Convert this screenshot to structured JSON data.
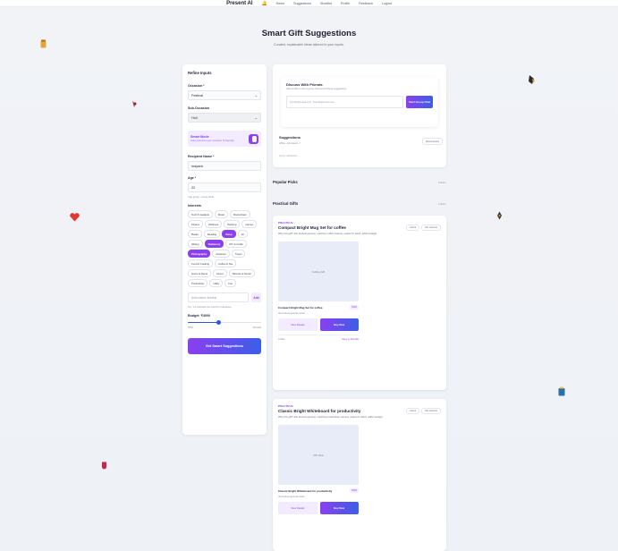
{
  "nav": {
    "brand": "Present AI",
    "links": [
      "Home",
      "Suggestions",
      "Shortlist",
      "Profile",
      "Feedback",
      "Logout"
    ]
  },
  "hero": {
    "title": "Smart Gift Suggestions",
    "subtitle": "Curated, explainable ideas tailored to your inputs."
  },
  "form": {
    "heading": "Refine Inputs",
    "occasion_label": "Occasion *",
    "occasion_value": "Festival",
    "sub_occasion_label": "Sub-Occasion",
    "sub_occasion_value": "Holi",
    "smart_mode_label": "Smart Mode",
    "smart_mode_desc": "Auto-optimizes per occasion & diversity",
    "recipient_label": "Recipient Name *",
    "recipient_value": "mayank",
    "age_label": "Age *",
    "age_value": "22",
    "age_hint": "Age group: young adult",
    "interests_label": "Interests",
    "interests": [
      {
        "label": "Tech & Gadgets",
        "on": false
      },
      {
        "label": "Music",
        "on": false
      },
      {
        "label": "Books/Gam",
        "on": false
      },
      {
        "label": "Fitness",
        "on": false
      },
      {
        "label": "Wellness",
        "on": false
      },
      {
        "label": "Painting",
        "on": false
      },
      {
        "label": "Games",
        "on": false
      },
      {
        "label": "Books",
        "on": false
      },
      {
        "label": "Reading",
        "on": false
      },
      {
        "label": "Sleep",
        "on": true
      },
      {
        "label": "Art",
        "on": false
      },
      {
        "label": "Writing",
        "on": false
      },
      {
        "label": "Stationery",
        "on": true
      },
      {
        "label": "DIY & Crafts",
        "on": false
      },
      {
        "label": "Photography",
        "on": true
      },
      {
        "label": "Outdoors",
        "on": false
      },
      {
        "label": "Travel",
        "on": false
      },
      {
        "label": "Food & Cooking",
        "on": false
      },
      {
        "label": "Coffee & Tea",
        "on": false
      },
      {
        "label": "Home & Decor",
        "on": false
      },
      {
        "label": "Decor",
        "on": false
      },
      {
        "label": "Parents & Social",
        "on": false
      },
      {
        "label": "Productivity",
        "on": false
      },
      {
        "label": "Utility",
        "on": false
      },
      {
        "label": "Fun",
        "on": false
      }
    ],
    "custom_placeholder": "Add custom interest",
    "add_label": "Add",
    "custom_hint": "Tip: 1-3 interests are best for relevance",
    "budget_label": "Budget: ₹4000",
    "budget_fraction": 0.42,
    "budget_min": "₹500",
    "budget_max": "₹10,000",
    "cta_label": "Get Smart Suggestions"
  },
  "discuss": {
    "title": "Discuss With Friends",
    "subtitle": "Add emails to start a group chat around these suggestions.",
    "input_placeholder": "friend1@email.com, friend2@email.com",
    "button_label": "Start Group Chat"
  },
  "suggestions": {
    "title": "Suggestions",
    "subtitle": "offline • job-based • f",
    "query": "Query: withdrawn",
    "toggle_label": "Deterministic"
  },
  "sections": {
    "popular": "Popular Picks",
    "popular_count": "0 items",
    "practical": "Practical Gifts",
    "practical_count": "2 items"
  },
  "gifts": [
    {
      "tag": "PRACTICAL",
      "title": "Compact Bright Mug Set for coffee",
      "why": "Why this gift? Fits festival general, matches coffee interest, suited for adult, within budget",
      "pill1": "Useful",
      "pill2": "Not relevant",
      "image_text": "Coffee Gift",
      "name": "Compact Bright Mug Set for coffee",
      "price": "₹462",
      "retailer": "Via festival general needs",
      "view_label": "View Details",
      "buy_label": "Buy Now",
      "foot_left": "Coffee",
      "foot_right": "Save to Shortlist"
    },
    {
      "tag": "PRACTICAL",
      "title": "Classic Bright Whiteboard for productivity",
      "why": "Why this gift? Fits festival general, matches productivity interest, suited for adult, within budget",
      "pill1": "Useful",
      "pill2": "Not relevant",
      "image_text": "Gift Idea",
      "name": "Classic Bright Whiteboard for productivity",
      "price": "₹682",
      "retailer": "Via festival general needs",
      "view_label": "View Details",
      "buy_label": "Buy Now"
    }
  ],
  "decor_icons": [
    "jar-icon",
    "bow-icon",
    "heart-icon",
    "stocking-icon",
    "bottle-icon",
    "feather-icon",
    "bag-icon"
  ]
}
